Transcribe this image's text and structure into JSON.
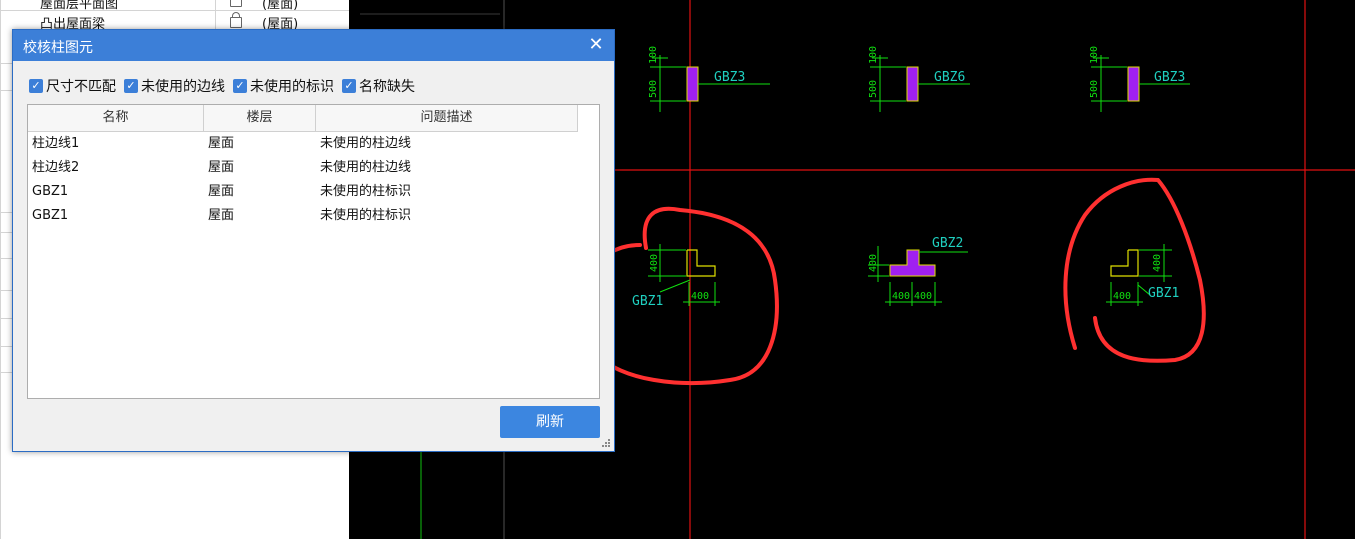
{
  "left_panel": {
    "rows": [
      {
        "name": "屋面层平面图",
        "floor": "(屋面)"
      },
      {
        "name": "凸出屋面梁",
        "floor": "(屋面)"
      }
    ]
  },
  "dialog": {
    "title": "校核柱图元",
    "close_symbol": "✕",
    "filters": [
      {
        "label": "尺寸不匹配",
        "checked": true
      },
      {
        "label": "未使用的边线",
        "checked": true
      },
      {
        "label": "未使用的标识",
        "checked": true
      },
      {
        "label": "名称缺失",
        "checked": true
      }
    ],
    "columns": [
      "名称",
      "楼层",
      "问题描述"
    ],
    "rows": [
      {
        "name": "柱边线1",
        "floor": "屋面",
        "desc": "未使用的柱边线"
      },
      {
        "name": "柱边线2",
        "floor": "屋面",
        "desc": "未使用的柱边线"
      },
      {
        "name": "GBZ1",
        "floor": "屋面",
        "desc": "未使用的柱标识"
      },
      {
        "name": "GBZ1",
        "floor": "屋面",
        "desc": "未使用的柱标识"
      }
    ],
    "refresh_label": "刷新"
  },
  "cad": {
    "columns": [
      {
        "label": "GBZ3",
        "dim_w": "100",
        "dim_h": "500"
      },
      {
        "label": "GBZ6",
        "dim_w": "100",
        "dim_h": "500"
      },
      {
        "label": "GBZ3",
        "dim_w": "100",
        "dim_h": "500"
      },
      {
        "label": "GBZ1",
        "dim_h": "400",
        "dim_w": "400"
      },
      {
        "label": "GBZ2",
        "dim_h": "400",
        "dim_w1": "400",
        "dim_w2": "400"
      },
      {
        "label": "GBZ1",
        "dim_h": "400",
        "dim_w": "400"
      }
    ],
    "colors": {
      "background": "#000000",
      "axis": "#e01010",
      "dim": "#10e010",
      "label": "#1fd0c0",
      "column_fill": "#a020f0",
      "column_outline": "#e0e000",
      "annotation": "#ff3030"
    }
  }
}
